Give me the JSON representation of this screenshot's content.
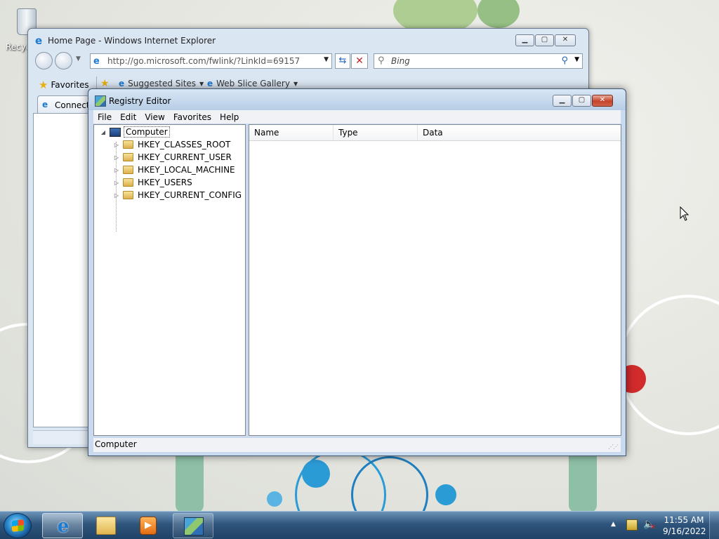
{
  "desktop": {
    "recycle_bin_label": "Recyc"
  },
  "ie": {
    "title": "Home Page - Windows Internet Explorer",
    "address": "http://go.microsoft.com/fwlink/?LinkId=69157",
    "search_placeholder": "Bing",
    "favorites_label": "Favorites",
    "suggested_sites": "Suggested Sites",
    "web_slice_gallery": "Web Slice Gallery",
    "tab_label": "Connecti"
  },
  "regedit": {
    "title": "Registry Editor",
    "menu": [
      "File",
      "Edit",
      "View",
      "Favorites",
      "Help"
    ],
    "tree_root": "Computer",
    "tree_items": [
      "HKEY_CLASSES_ROOT",
      "HKEY_CURRENT_USER",
      "HKEY_LOCAL_MACHINE",
      "HKEY_USERS",
      "HKEY_CURRENT_CONFIG"
    ],
    "columns": [
      "Name",
      "Type",
      "Data"
    ],
    "status": "Computer"
  },
  "taskbar": {
    "time": "11:55 AM",
    "date": "9/16/2022"
  },
  "colors": {
    "taskbar": "#2f557c",
    "title_blue": "#c9daee",
    "close_red": "#c4442b"
  }
}
